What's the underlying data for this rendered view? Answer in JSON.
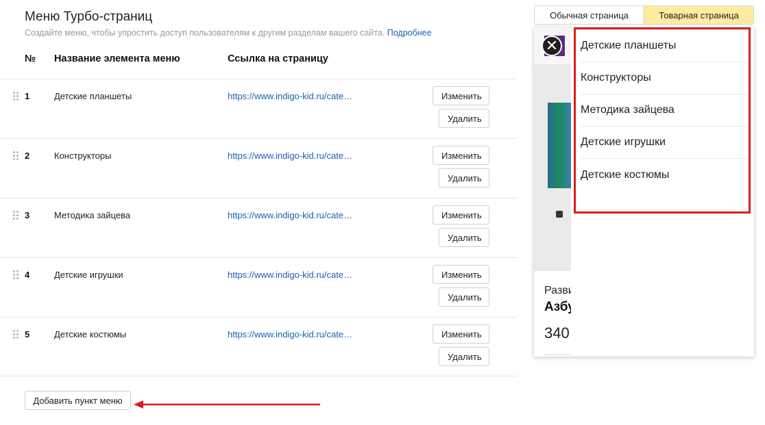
{
  "header": {
    "title": "Меню Турбо-страниц",
    "subtitle": "Создайте меню, чтобы упростить доступ пользователям к другим разделам вашего сайта.",
    "more_link": "Подробнее"
  },
  "table": {
    "columns": [
      "№",
      "Название элемента меню",
      "Ссылка на страницу"
    ],
    "rows": [
      {
        "num": "1",
        "name": "Детские планшеты",
        "link": "https://www.indigo-kid.ru/cate…"
      },
      {
        "num": "2",
        "name": "Конструкторы",
        "link": "https://www.indigo-kid.ru/cate…"
      },
      {
        "num": "3",
        "name": "Методика зайцева",
        "link": "https://www.indigo-kid.ru/cate…"
      },
      {
        "num": "4",
        "name": "Детские игрушки",
        "link": "https://www.indigo-kid.ru/cate…"
      },
      {
        "num": "5",
        "name": "Детские костюмы",
        "link": "https://www.indigo-kid.ru/cate…"
      }
    ],
    "edit_label": "Изменить",
    "delete_label": "Удалить"
  },
  "add_button": "Добавить пункт меню",
  "preview": {
    "toggle": [
      "Обычная страница",
      "Товарная страница"
    ],
    "active_toggle": "Товарная страница",
    "close_glyph": "✕",
    "menu_items": [
      "Детские планшеты",
      "Конструкторы",
      "Методика зайцева",
      "Детские игрушки",
      "Детские костюмы"
    ],
    "background_text": [
      "Разви",
      "Азбу",
      "340"
    ]
  },
  "colors": {
    "link": "#1a5fb4",
    "toggle_active": "#ffeba0",
    "annotation_red": "#d91d1d"
  }
}
